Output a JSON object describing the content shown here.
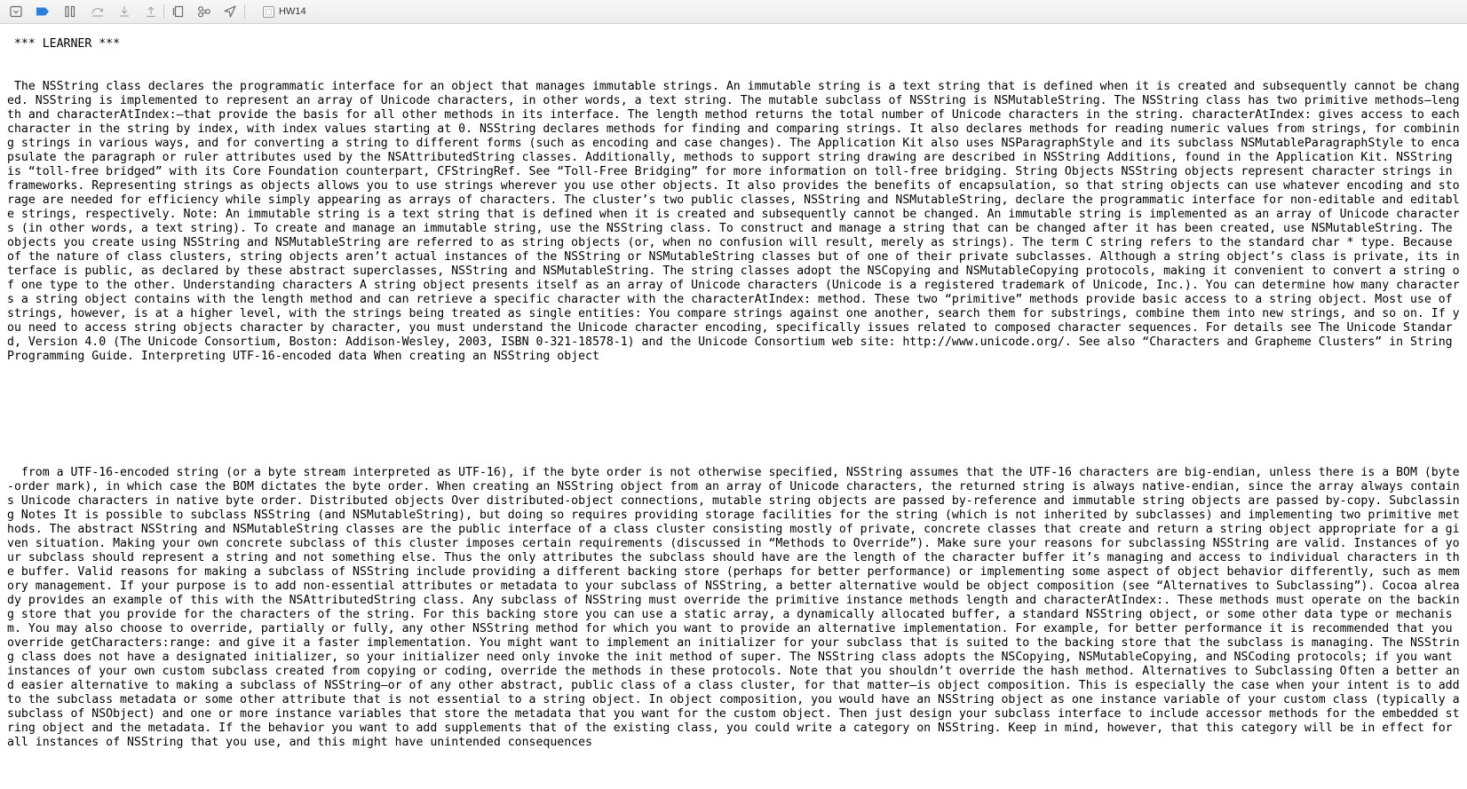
{
  "toolbar": {
    "icons": [
      "hide-debug-area-icon",
      "breakpoints-toggle-icon",
      "pause-icon",
      "step-over-icon",
      "step-into-icon",
      "step-out-icon",
      "view-hierarchy-icon",
      "memory-graph-icon",
      "simulate-location-icon"
    ],
    "breadcrumb": "HW14"
  },
  "console": {
    "title": " *** LEARNER ***",
    "paragraph1": " The NSString class declares the programmatic interface for an object that manages immutable strings. An immutable string is a text string that is defined when it is created and subsequently cannot be changed. NSString is implemented to represent an array of Unicode characters, in other words, a text string. The mutable subclass of NSString is NSMutableString. The NSString class has two primitive methods—length and characterAtIndex:—that provide the basis for all other methods in its interface. The length method returns the total number of Unicode characters in the string. characterAtIndex: gives access to each character in the string by index, with index values starting at 0. NSString declares methods for finding and comparing strings. It also declares methods for reading numeric values from strings, for combining strings in various ways, and for converting a string to different forms (such as encoding and case changes). The Application Kit also uses NSParagraphStyle and its subclass NSMutableParagraphStyle to encapsulate the paragraph or ruler attributes used by the NSAttributedString classes. Additionally, methods to support string drawing are described in NSString Additions, found in the Application Kit. NSString is “toll-free bridged” with its Core Foundation counterpart, CFStringRef. See “Toll-Free Bridging” for more information on toll-free bridging. String Objects NSString objects represent character strings in frameworks. Representing strings as objects allows you to use strings wherever you use other objects. It also provides the benefits of encapsulation, so that string objects can use whatever encoding and storage are needed for efficiency while simply appearing as arrays of characters. The cluster’s two public classes, NSString and NSMutableString, declare the programmatic interface for non-editable and editable strings, respectively. Note: An immutable string is a text string that is defined when it is created and subsequently cannot be changed. An immutable string is implemented as an array of Unicode characters (in other words, a text string). To create and manage an immutable string, use the NSString class. To construct and manage a string that can be changed after it has been created, use NSMutableString. The objects you create using NSString and NSMutableString are referred to as string objects (or, when no confusion will result, merely as strings). The term C string refers to the standard char * type. Because of the nature of class clusters, string objects aren’t actual instances of the NSString or NSMutableString classes but of one of their private subclasses. Although a string object’s class is private, its interface is public, as declared by these abstract superclasses, NSString and NSMutableString. The string classes adopt the NSCopying and NSMutableCopying protocols, making it convenient to convert a string of one type to the other. Understanding characters A string object presents itself as an array of Unicode characters (Unicode is a registered trademark of Unicode, Inc.). You can determine how many characters a string object contains with the length method and can retrieve a specific character with the characterAtIndex: method. These two “primitive” methods provide basic access to a string object. Most use of strings, however, is at a higher level, with the strings being treated as single entities: You compare strings against one another, search them for substrings, combine them into new strings, and so on. If you need to access string objects character by character, you must understand the Unicode character encoding, specifically issues related to composed character sequences. For details see The Unicode Standard, Version 4.0 (The Unicode Consortium, Boston: Addison-Wesley, 2003, ISBN 0-321-18578-1) and the Unicode Consortium web site: http://www.unicode.org/. See also “Characters and Grapheme Clusters” in String Programming Guide. Interpreting UTF-16-encoded data When creating an NSString object",
    "paragraph2": "  from a UTF-16-encoded string (or a byte stream interpreted as UTF-16), if the byte order is not otherwise specified, NSString assumes that the UTF-16 characters are big-endian, unless there is a BOM (byte-order mark), in which case the BOM dictates the byte order. When creating an NSString object from an array of Unicode characters, the returned string is always native-endian, since the array always contains Unicode characters in native byte order. Distributed objects Over distributed-object connections, mutable string objects are passed by-reference and immutable string objects are passed by-copy. Subclassing Notes It is possible to subclass NSString (and NSMutableString), but doing so requires providing storage facilities for the string (which is not inherited by subclasses) and implementing two primitive methods. The abstract NSString and NSMutableString classes are the public interface of a class cluster consisting mostly of private, concrete classes that create and return a string object appropriate for a given situation. Making your own concrete subclass of this cluster imposes certain requirements (discussed in “Methods to Override”). Make sure your reasons for subclassing NSString are valid. Instances of your subclass should represent a string and not something else. Thus the only attributes the subclass should have are the length of the character buffer it’s managing and access to individual characters in the buffer. Valid reasons for making a subclass of NSString include providing a different backing store (perhaps for better performance) or implementing some aspect of object behavior differently, such as memory management. If your purpose is to add non-essential attributes or metadata to your subclass of NSString, a better alternative would be object composition (see “Alternatives to Subclassing”). Cocoa already provides an example of this with the NSAttributedString class. Any subclass of NSString must override the primitive instance methods length and characterAtIndex:. These methods must operate on the backing store that you provide for the characters of the string. For this backing store you can use a static array, a dynamically allocated buffer, a standard NSString object, or some other data type or mechanism. You may also choose to override, partially or fully, any other NSString method for which you want to provide an alternative implementation. For example, for better performance it is recommended that you override getCharacters:range: and give it a faster implementation. You might want to implement an initializer for your subclass that is suited to the backing store that the subclass is managing. The NSString class does not have a designated initializer, so your initializer need only invoke the init method of super. The NSString class adopts the NSCopying, NSMutableCopying, and NSCoding protocols; if you want instances of your own custom subclass created from copying or coding, override the methods in these protocols. Note that you shouldn’t override the hash method. Alternatives to Subclassing Often a better and easier alternative to making a subclass of NSString—or of any other abstract, public class of a class cluster, for that matter—is object composition. This is especially the case when your intent is to add to the subclass metadata or some other attribute that is not essential to a string object. In object composition, you would have an NSString object as one instance variable of your custom class (typically a subclass of NSObject) and one or more instance variables that store the metadata that you want for the custom object. Then just design your subclass interface to include accessor methods for the embedded string object and the metadata. If the behavior you want to add supplements that of the existing class, you could write a category on NSString. Keep in mind, however, that this category will be in effect for all instances of NSString that you use, and this might have unintended consequences"
  },
  "colors": {
    "breakpoint_accent": "#2a7fe0",
    "toolbar_icon": "#6b6b6b"
  }
}
